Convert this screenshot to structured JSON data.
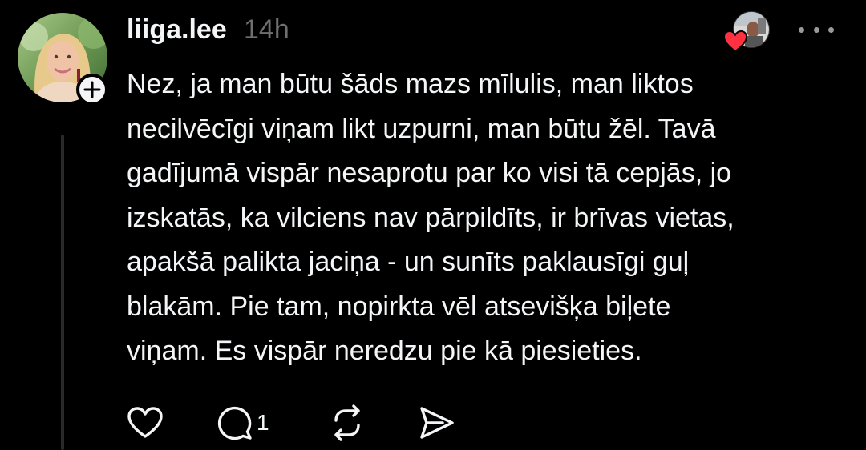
{
  "post": {
    "username": "liiga.lee",
    "time": "14h",
    "text": "Nez, ja man būtu šāds mazs mīlulis, man liktos\nnecilvēcīgi viņam likt uzpurni, man būtu žēl. Tavā\ngadījumā vispār nesaprotu par ko visi tā cepjās, jo\nizskatās, ka vilciens nav pārpildīts, ir brīvas vietas,\napakšā palikta jaciņa - un sunīts paklausīgi guļ\nblakām. Pie tam, nopirkta vēl atsevišķa biļete\nviņam. Es vispār neredzu pie kā piesieties.",
    "reply_count": "1"
  },
  "icons": {
    "avatar": "profile-photo",
    "follow": "plus-icon",
    "liker": "liked-by-avatar",
    "heart_badge": "heart-icon",
    "more": "more-icon",
    "like": "heart-outline-icon",
    "reply": "comment-icon",
    "repost": "repost-icon",
    "share": "send-icon"
  },
  "colors": {
    "background": "#000000",
    "text": "#f3f5f7",
    "muted": "#6f6f6f",
    "heart": "#ff3040"
  }
}
